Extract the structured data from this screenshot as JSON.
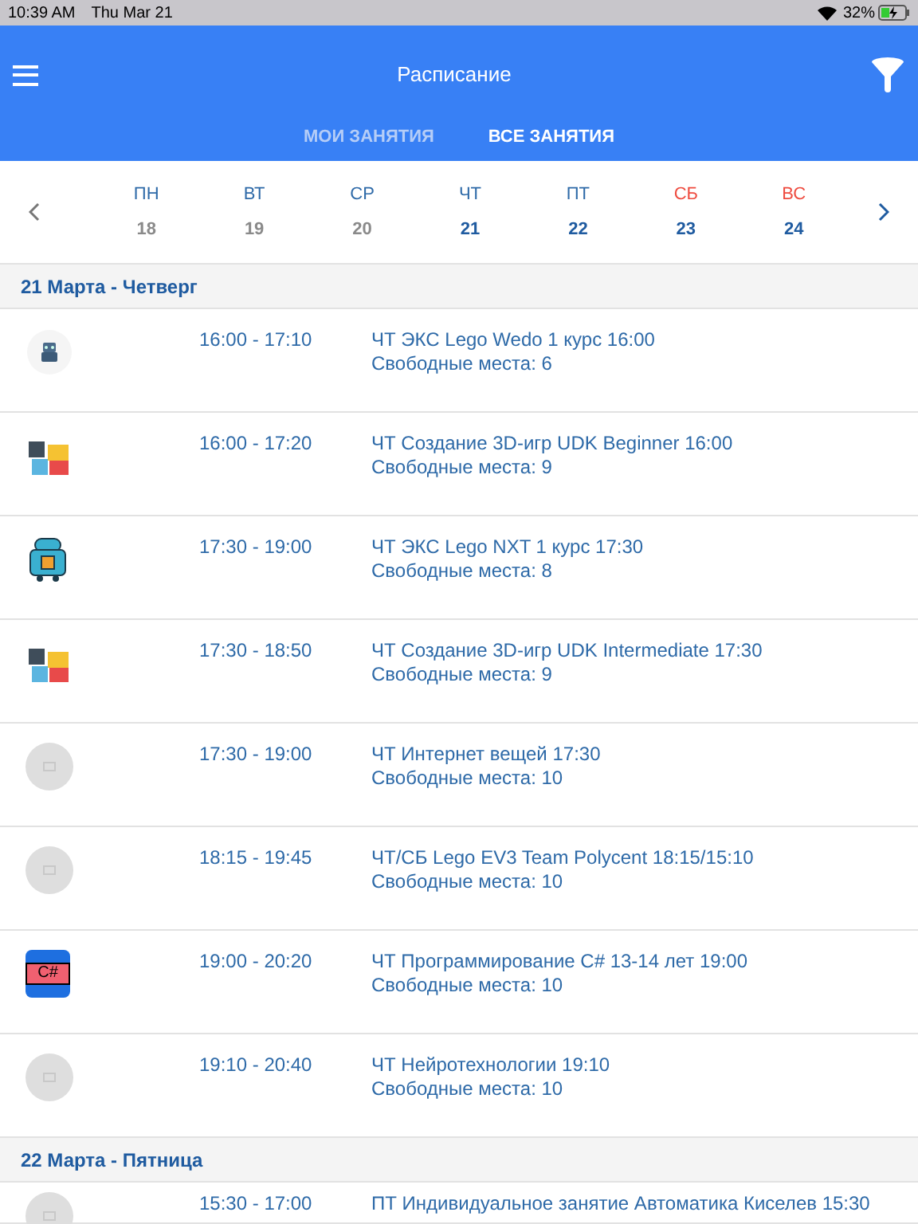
{
  "status_bar": {
    "time": "10:39 AM",
    "date": "Thu Mar 21",
    "battery": "32%"
  },
  "header": {
    "title": "Расписание"
  },
  "tabs": [
    {
      "label": "МОИ ЗАНЯТИЯ",
      "selected": false
    },
    {
      "label": "ВСЕ ЗАНЯТИЯ",
      "selected": true
    }
  ],
  "week": [
    {
      "day": "ПН",
      "date": "18",
      "past": true,
      "weekend": false
    },
    {
      "day": "ВТ",
      "date": "19",
      "past": true,
      "weekend": false
    },
    {
      "day": "СР",
      "date": "20",
      "past": true,
      "weekend": false
    },
    {
      "day": "ЧТ",
      "date": "21",
      "past": false,
      "weekend": false
    },
    {
      "day": "ПТ",
      "date": "22",
      "past": false,
      "weekend": false
    },
    {
      "day": "СБ",
      "date": "23",
      "past": false,
      "weekend": true
    },
    {
      "day": "ВС",
      "date": "24",
      "past": false,
      "weekend": true
    }
  ],
  "sections": [
    {
      "title": "21 Марта - Четверг",
      "lessons": [
        {
          "kind": "small-robot",
          "time": "16:00 - 17:10",
          "title": "ЧТ ЭКС Lego Wedo 1 курс 16:00",
          "seats": "Свободные места: 6"
        },
        {
          "kind": "puzzle",
          "time": "16:00 - 17:20",
          "title": "ЧТ Создание 3D-игр UDK Beginner 16:00",
          "seats": "Свободные места: 9"
        },
        {
          "kind": "robot",
          "time": "17:30 - 19:00",
          "title": "ЧТ ЭКС Lego NXT 1 курс 17:30",
          "seats": "Свободные места: 8"
        },
        {
          "kind": "puzzle",
          "time": "17:30 - 18:50",
          "title": "ЧТ Создание 3D-игр UDK Intermediate 17:30",
          "seats": "Свободные места: 9"
        },
        {
          "kind": "placeholder",
          "time": "17:30 - 19:00",
          "title": "ЧТ Интернет вещей 17:30",
          "seats": "Свободные места: 10"
        },
        {
          "kind": "placeholder",
          "time": "18:15 - 19:45",
          "title": "ЧТ/СБ Lego EV3 Team Polycent 18:15/15:10",
          "seats": "Свободные места: 10"
        },
        {
          "kind": "file",
          "icon_label": "C#",
          "time": "19:00 - 20:20",
          "title": "ЧТ Программирование C# 13-14 лет 19:00",
          "seats": "Свободные места: 10"
        },
        {
          "kind": "placeholder",
          "time": "19:10 - 20:40",
          "title": "ЧТ Нейротехнологии 19:10",
          "seats": "Свободные места: 10"
        }
      ]
    },
    {
      "title": "22 Марта - Пятница",
      "lessons": [
        {
          "kind": "placeholder",
          "time": "15:30 - 17:00",
          "title": "ПТ Индивидуальное занятие Автоматика Киселев 15:30"
        }
      ]
    }
  ]
}
